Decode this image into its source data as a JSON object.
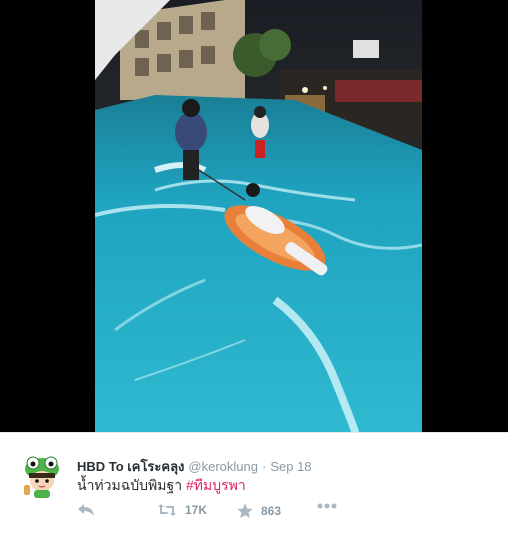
{
  "tweet": {
    "fullname": "HBD To เคโระคลุง",
    "username": "@keroklung",
    "separator": "·",
    "date": "Sep 18",
    "text_main": "น้ำท่วมฉบับพิมฐา",
    "hashtag": "#ทีมบูรพา"
  },
  "actions": {
    "retweet_count": "17K",
    "favorite_count": "863"
  },
  "colors": {
    "hashtag": "#e0245e",
    "meta": "#8899a6",
    "text": "#292f33",
    "water": "#2aa8c3"
  },
  "icons": [
    "reply-icon",
    "retweet-icon",
    "favorite-icon",
    "more-icon"
  ]
}
